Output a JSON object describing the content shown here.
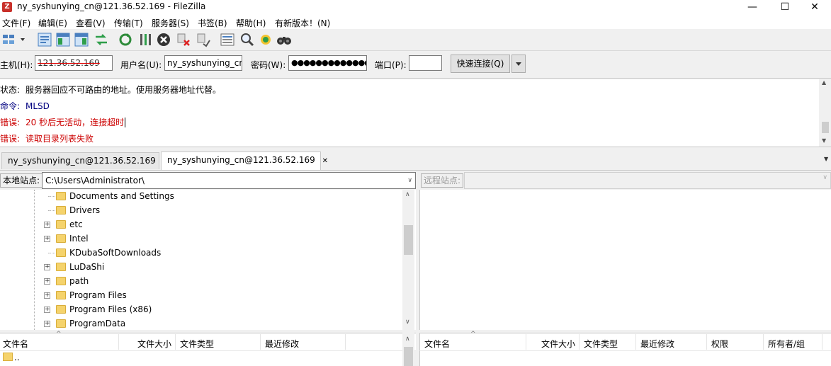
{
  "window": {
    "title": "ny_syshunying_cn@121.36.52.169 - FileZilla",
    "app_icon": "Z",
    "controls": {
      "minimize": "—",
      "maximize": "☐",
      "close": "✕"
    }
  },
  "menu": [
    "文件(F)",
    "编辑(E)",
    "查看(V)",
    "传输(T)",
    "服务器(S)",
    "书签(B)",
    "帮助(H)",
    "有新版本！(N)"
  ],
  "quickconnect": {
    "host_label": "主机(H):",
    "host_value": "121.36.52.169",
    "user_label": "用户名(U):",
    "user_value": "ny_syshunying_cn",
    "pass_label": "密码(W):",
    "pass_value": "●●●●●●●●●●●●●",
    "port_label": "端口(P):",
    "port_value": "",
    "button_label": "快速连接(Q)"
  },
  "log": [
    {
      "tag": "状态:",
      "text": "服务器回应不可路由的地址。使用服务器地址代替。",
      "color": "#000000"
    },
    {
      "tag": "命令:",
      "text": "MLSD",
      "color": "#000080"
    },
    {
      "tag": "错误:",
      "text": "20 秒后无活动，连接超时",
      "color": "#cc0000"
    },
    {
      "tag": "错误:",
      "text": "读取目录列表失败",
      "color": "#cc0000"
    }
  ],
  "tabs": [
    {
      "label": "ny_syshunying_cn@121.36.52.169",
      "active": false
    },
    {
      "label": "ny_syshunying_cn@121.36.52.169",
      "active": true,
      "close": "✕"
    }
  ],
  "local": {
    "site_label": "本地站点:",
    "path": "C:\\Users\\Administrator\\",
    "tree": [
      {
        "name": "Documents and Settings",
        "expandable": false
      },
      {
        "name": "Drivers",
        "expandable": false
      },
      {
        "name": "etc",
        "expandable": true
      },
      {
        "name": "Intel",
        "expandable": true
      },
      {
        "name": "KDubaSoftDownloads",
        "expandable": false
      },
      {
        "name": "LuDaShi",
        "expandable": true
      },
      {
        "name": "path",
        "expandable": true
      },
      {
        "name": "Program Files",
        "expandable": true
      },
      {
        "name": "Program Files (x86)",
        "expandable": true
      },
      {
        "name": "ProgramData",
        "expandable": true
      }
    ],
    "columns": [
      "文件名",
      "文件大小",
      "文件类型",
      "最近修改"
    ],
    "files": [
      ".."
    ]
  },
  "remote": {
    "site_label": "远程站点:",
    "columns": [
      "文件名",
      "文件大小",
      "文件类型",
      "最近修改",
      "权限",
      "所有者/组"
    ]
  },
  "colors": {
    "folder": "#f5d36c",
    "error": "#cc0000",
    "command": "#000080"
  }
}
